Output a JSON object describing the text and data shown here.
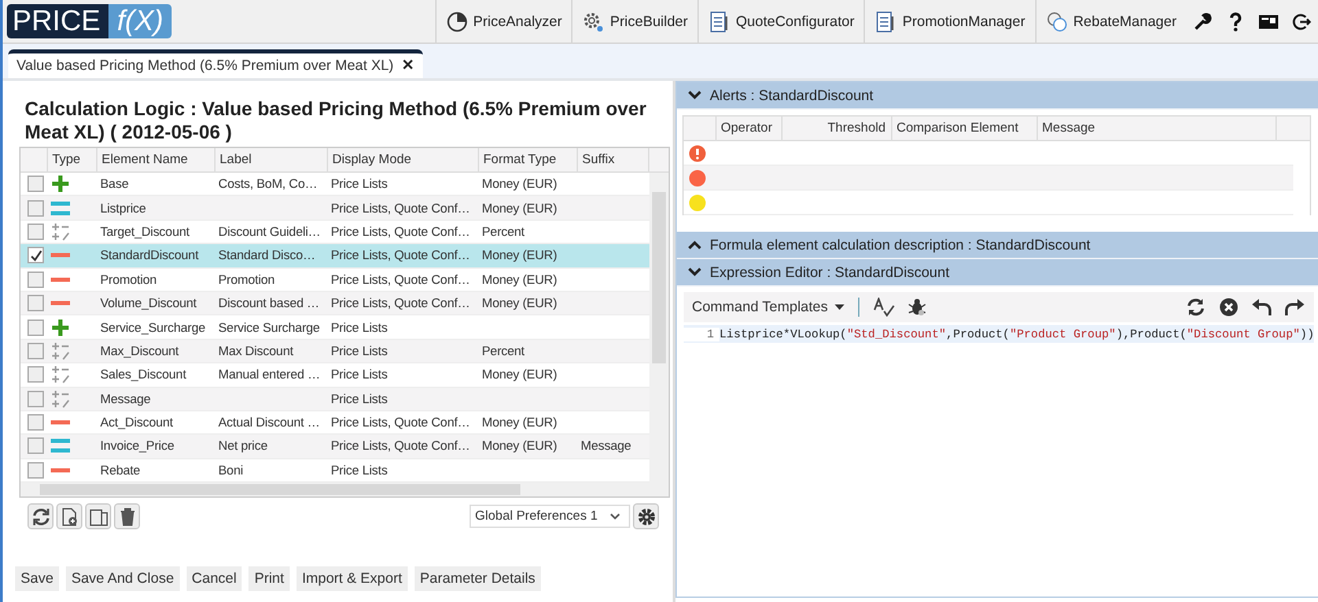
{
  "logo": {
    "left": "PRICE",
    "right": "f(X)"
  },
  "nav": [
    "PriceAnalyzer",
    "PriceBuilder",
    "QuoteConfigurator",
    "PromotionManager",
    "RebateManager"
  ],
  "doc_tab": {
    "label": "Value based Pricing Method (6.5% Premium over Meat XL)",
    "close": "✕"
  },
  "title": "Calculation Logic : Value based Pricing Method (6.5% Premium over Meat XL) ( 2012-05-06 )",
  "table": {
    "columns": [
      "Type",
      "Element Name",
      "Label",
      "Display Mode",
      "Format Type",
      "Suffix"
    ],
    "rows": [
      {
        "checked": false,
        "selected": false,
        "kind": "plus",
        "name": "Base",
        "label": "Costs, BoM, Co…",
        "display": "Price Lists",
        "format": "Money (EUR)",
        "suffix": ""
      },
      {
        "checked": false,
        "selected": false,
        "kind": "equals",
        "name": "Listprice",
        "label": "",
        "display": "Price Lists, Quote Conf…",
        "format": "Money (EUR)",
        "suffix": ""
      },
      {
        "checked": false,
        "selected": false,
        "kind": "formula",
        "name": "Target_Discount",
        "label": "Discount Guideli…",
        "display": "Price Lists, Quote Conf…",
        "format": "Percent",
        "suffix": ""
      },
      {
        "checked": true,
        "selected": true,
        "kind": "minus",
        "name": "StandardDiscount",
        "label": "Standard Disco…",
        "display": "Price Lists, Quote Conf…",
        "format": "Money (EUR)",
        "suffix": ""
      },
      {
        "checked": false,
        "selected": false,
        "kind": "minus",
        "name": "Promotion",
        "label": "Promotion",
        "display": "Price Lists, Quote Conf…",
        "format": "Money (EUR)",
        "suffix": ""
      },
      {
        "checked": false,
        "selected": false,
        "kind": "minus",
        "name": "Volume_Discount",
        "label": "Discount based …",
        "display": "Price Lists, Quote Conf…",
        "format": "Money (EUR)",
        "suffix": ""
      },
      {
        "checked": false,
        "selected": false,
        "kind": "plus",
        "name": "Service_Surcharge",
        "label": "Service Surcharge",
        "display": "Price Lists",
        "format": "",
        "suffix": ""
      },
      {
        "checked": false,
        "selected": false,
        "kind": "formula",
        "name": "Max_Discount",
        "label": "Max Discount",
        "display": "Price Lists",
        "format": "Percent",
        "suffix": ""
      },
      {
        "checked": false,
        "selected": false,
        "kind": "formula",
        "name": "Sales_Discount",
        "label": "Manual entered …",
        "display": "Price Lists",
        "format": "Money (EUR)",
        "suffix": ""
      },
      {
        "checked": false,
        "selected": false,
        "kind": "formula",
        "name": "Message",
        "label": "",
        "display": "Price Lists",
        "format": "",
        "suffix": ""
      },
      {
        "checked": false,
        "selected": false,
        "kind": "minus",
        "name": "Act_Discount",
        "label": "Actual Discount …",
        "display": "Price Lists, Quote Conf…",
        "format": "Money (EUR)",
        "suffix": ""
      },
      {
        "checked": false,
        "selected": false,
        "kind": "equals",
        "name": "Invoice_Price",
        "label": "Net price",
        "display": "Price Lists, Quote Conf…",
        "format": "Money (EUR)",
        "suffix": "Message"
      },
      {
        "checked": false,
        "selected": false,
        "kind": "minus",
        "name": "Rebate",
        "label": "Boni",
        "display": "Price Lists",
        "format": "",
        "suffix": ""
      }
    ]
  },
  "preferences": {
    "value": "Global Preferences 1"
  },
  "actions": [
    "Save",
    "Save And Close",
    "Cancel",
    "Print",
    "Import & Export",
    "Parameter Details"
  ],
  "alerts": {
    "header": "Alerts : StandardDiscount",
    "expanded": true,
    "columns": [
      "Operator",
      "Threshold",
      "Comparison Element",
      "Message"
    ],
    "rows": [
      {
        "kind": "error",
        "color": "#f0603c"
      },
      {
        "kind": "dot",
        "color": "#fa6446"
      },
      {
        "kind": "dot",
        "color": "#f7e11e"
      }
    ]
  },
  "description": {
    "header": "Formula element calculation description : StandardDiscount",
    "expanded": false
  },
  "editor": {
    "header": "Expression Editor : StandardDiscount",
    "expanded": true,
    "templates": "Command Templates",
    "line_number": "1",
    "code": [
      {
        "kind": "plain",
        "text": "Listprice*VLookup("
      },
      {
        "kind": "string",
        "text": "\"Std_Discount\""
      },
      {
        "kind": "plain",
        "text": ",Product("
      },
      {
        "kind": "string",
        "text": "\"Product Group\""
      },
      {
        "kind": "plain",
        "text": "),Product("
      },
      {
        "kind": "string",
        "text": "\"Discount Group\""
      },
      {
        "kind": "plain",
        "text": "))"
      }
    ]
  }
}
